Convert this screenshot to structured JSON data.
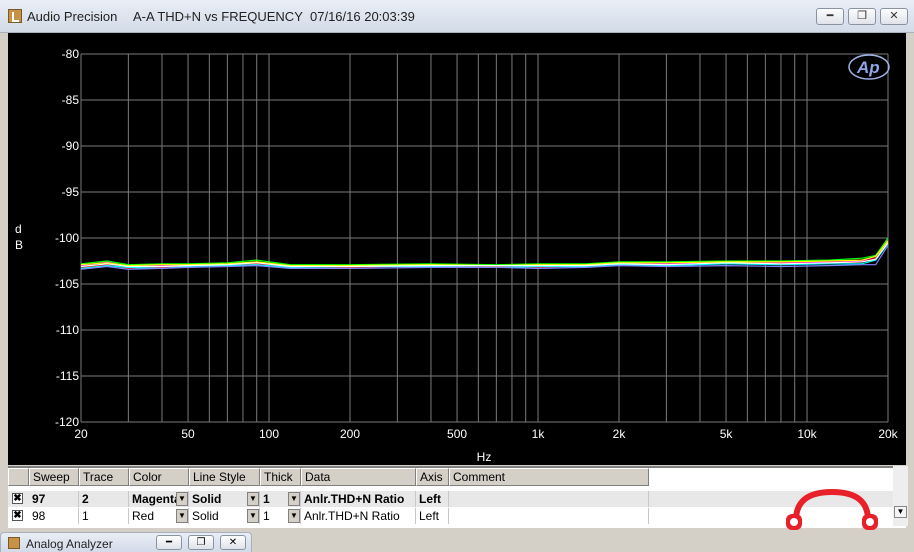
{
  "window": {
    "app_title": "Audio Precision",
    "graph_title": "A-A THD+N vs FREQUENCY",
    "timestamp": "07/16/16 20:03:39",
    "minimize_icon": "minimize-icon",
    "restore_icon": "restore-icon",
    "close_icon": "close-icon"
  },
  "chart_data": {
    "type": "line",
    "ylabel": "d\nB",
    "xlabel": "Hz",
    "x_scale": "log",
    "xlim": [
      20,
      20000
    ],
    "ylim": [
      -120,
      -80
    ],
    "y_ticks": [
      -80,
      -85,
      -90,
      -95,
      -100,
      -105,
      -110,
      -115,
      -120
    ],
    "x_ticks": [
      {
        "value": 20,
        "label": "20"
      },
      {
        "value": 50,
        "label": "50"
      },
      {
        "value": 100,
        "label": "100"
      },
      {
        "value": 200,
        "label": "200"
      },
      {
        "value": 500,
        "label": "500"
      },
      {
        "value": 1000,
        "label": "1k"
      },
      {
        "value": 2000,
        "label": "2k"
      },
      {
        "value": 5000,
        "label": "5k"
      },
      {
        "value": 10000,
        "label": "10k"
      },
      {
        "value": 20000,
        "label": "20k"
      }
    ],
    "grid": true,
    "background": "#000000",
    "grid_color": "#7a7a7a",
    "series": [
      {
        "color": "#ff00ff",
        "x": [
          20,
          25,
          30,
          40,
          50,
          70,
          90,
          120,
          200,
          400,
          700,
          1000,
          1500,
          2000,
          3000,
          5000,
          8000,
          12000,
          16000,
          18000,
          20000
        ],
        "y": [
          -103.0,
          -102.6,
          -103.1,
          -103.0,
          -102.9,
          -102.8,
          -102.7,
          -103.0,
          -103.0,
          -102.9,
          -103.0,
          -103.0,
          -102.9,
          -102.7,
          -102.8,
          -102.6,
          -102.7,
          -102.6,
          -102.5,
          -102.0,
          -100.2
        ]
      },
      {
        "color": "#ff0000",
        "x": [
          20,
          25,
          30,
          40,
          50,
          70,
          90,
          120,
          200,
          400,
          700,
          1000,
          1500,
          2000,
          3000,
          5000,
          8000,
          12000,
          16000,
          18000,
          20000
        ],
        "y": [
          -103.2,
          -102.9,
          -103.3,
          -103.2,
          -103.0,
          -102.9,
          -102.8,
          -103.1,
          -103.2,
          -103.0,
          -103.1,
          -103.2,
          -103.0,
          -102.8,
          -102.9,
          -102.7,
          -102.8,
          -102.7,
          -102.6,
          -102.2,
          -100.4
        ]
      },
      {
        "color": "#00ff00",
        "x": [
          20,
          25,
          30,
          40,
          50,
          70,
          90,
          120,
          200,
          400,
          700,
          1000,
          1500,
          2000,
          3000,
          5000,
          8000,
          12000,
          16000,
          18000,
          20000
        ],
        "y": [
          -102.8,
          -102.5,
          -102.9,
          -102.8,
          -102.8,
          -102.7,
          -102.4,
          -102.9,
          -102.9,
          -102.8,
          -102.9,
          -102.8,
          -102.8,
          -102.6,
          -102.6,
          -102.5,
          -102.5,
          -102.4,
          -102.2,
          -101.9,
          -100.0
        ]
      },
      {
        "color": "#00ffff",
        "x": [
          20,
          25,
          30,
          40,
          50,
          70,
          90,
          120,
          200,
          400,
          700,
          1000,
          1500,
          2000,
          3000,
          5000,
          8000,
          12000,
          16000,
          18000,
          20000
        ],
        "y": [
          -103.3,
          -103.0,
          -103.2,
          -103.3,
          -103.1,
          -103.0,
          -102.9,
          -103.2,
          -103.1,
          -103.1,
          -103.2,
          -103.1,
          -103.1,
          -102.9,
          -103.0,
          -102.8,
          -102.9,
          -102.8,
          -102.8,
          -102.4,
          -100.6
        ]
      },
      {
        "color": "#ffff00",
        "x": [
          20,
          25,
          30,
          40,
          50,
          70,
          90,
          120,
          200,
          400,
          700,
          1000,
          1500,
          2000,
          3000,
          5000,
          8000,
          12000,
          16000,
          18000,
          20000
        ],
        "y": [
          -102.9,
          -102.7,
          -103.0,
          -102.9,
          -102.9,
          -102.8,
          -102.6,
          -103.0,
          -103.0,
          -102.9,
          -103.0,
          -102.9,
          -102.9,
          -102.7,
          -102.7,
          -102.6,
          -102.6,
          -102.5,
          -102.4,
          -102.0,
          -100.3
        ]
      },
      {
        "color": "#ffffff",
        "x": [
          20,
          25,
          30,
          40,
          50,
          70,
          90,
          120,
          200,
          400,
          700,
          1000,
          1500,
          2000,
          3000,
          5000,
          8000,
          12000,
          16000,
          18000,
          20000
        ],
        "y": [
          -103.1,
          -102.8,
          -103.1,
          -103.1,
          -103.0,
          -102.9,
          -102.7,
          -103.1,
          -103.1,
          -103.0,
          -103.0,
          -103.0,
          -103.0,
          -102.8,
          -102.9,
          -102.7,
          -102.8,
          -102.7,
          -102.6,
          -102.3,
          -100.5
        ]
      },
      {
        "color": "#8080ff",
        "x": [
          20,
          25,
          30,
          40,
          50,
          70,
          90,
          120,
          200,
          400,
          700,
          1000,
          1500,
          2000,
          3000,
          5000,
          8000,
          12000,
          16000,
          18000,
          20000
        ],
        "y": [
          -103.4,
          -103.1,
          -103.4,
          -103.3,
          -103.2,
          -103.1,
          -103.0,
          -103.3,
          -103.3,
          -103.2,
          -103.2,
          -103.3,
          -103.2,
          -103.0,
          -103.1,
          -103.0,
          -103.1,
          -103.0,
          -102.9,
          -102.9,
          -100.8
        ]
      }
    ]
  },
  "table": {
    "headers": [
      "Sweep",
      "Trace",
      "Color",
      "Line Style",
      "Thick",
      "Data",
      "Axis",
      "Comment"
    ],
    "rows": [
      {
        "checked": "✖",
        "sweep": "97",
        "trace": "2",
        "color": "Magenta",
        "line_style": "Solid",
        "thick": "1",
        "data": "Anlr.THD+N Ratio",
        "axis": "Left",
        "comment": ""
      },
      {
        "checked": "✖",
        "sweep": "98",
        "trace": "1",
        "color": "Red",
        "line_style": "Solid",
        "thick": "1",
        "data": "Anlr.THD+N Ratio",
        "axis": "Left",
        "comment": ""
      }
    ]
  },
  "minimized_window": {
    "title": "Analog Analyzer"
  },
  "brand_logo": "Ap",
  "watermark_logo": "headphone-logo"
}
